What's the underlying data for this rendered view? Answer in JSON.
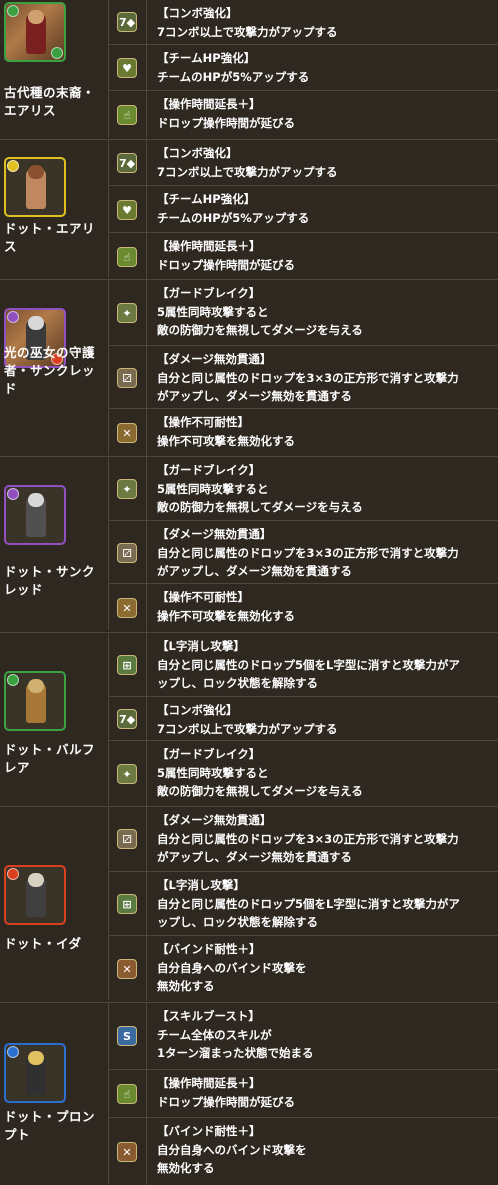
{
  "colors": {
    "background": "#2e2820",
    "grid_line": "#50463a",
    "text": "#ffffff",
    "attr_fire": "#d94020",
    "attr_water": "#2a70d0",
    "attr_wood": "#3aa040",
    "attr_light": "#e0c020",
    "attr_dark": "#9050c0"
  },
  "characters": [
    {
      "name": "古代種の末裔・\nエアリス",
      "avatar": "aerith-portrait-icon",
      "main_attr": "wood",
      "sub_attr": "wood",
      "awakenings": [
        {
          "icon": "combo-boost-icon",
          "glyph": "7◆",
          "title": "【コンボ強化】",
          "text": "7コンボ以上で攻撃力がアップする"
        },
        {
          "icon": "team-hp-boost-icon",
          "glyph": "♥",
          "title": "【チームHP強化】",
          "text": "チームのHPが5%アップする"
        },
        {
          "icon": "time-extend-plus-icon",
          "glyph": "☝",
          "title": "【操作時間延長＋】",
          "text": "ドロップ操作時間が延びる"
        }
      ]
    },
    {
      "name": "ドット・エアリ\nス",
      "avatar": "dot-aerith-sprite-icon",
      "main_attr": "light",
      "sub_attr": "",
      "awakenings": [
        {
          "icon": "combo-boost-icon",
          "glyph": "7◆",
          "title": "【コンボ強化】",
          "text": "7コンボ以上で攻撃力がアップする"
        },
        {
          "icon": "team-hp-boost-icon",
          "glyph": "♥",
          "title": "【チームHP強化】",
          "text": "チームのHPが5%アップする"
        },
        {
          "icon": "time-extend-plus-icon",
          "glyph": "☝",
          "title": "【操作時間延長＋】",
          "text": "ドロップ操作時間が延びる"
        }
      ]
    },
    {
      "name": "光の巫女の守護\n者・サンクレッ\nド",
      "avatar": "sankred-portrait-icon",
      "main_attr": "dark",
      "sub_attr": "fire",
      "awakenings": [
        {
          "icon": "guard-break-icon",
          "glyph": "✦",
          "title": "【ガードブレイク】",
          "text": "5属性同時攻撃すると\n敵の防御力を無視してダメージを与える"
        },
        {
          "icon": "damage-void-pierce-icon",
          "glyph": "⚂",
          "title": "【ダメージ無効貫通】",
          "text": "自分と同じ属性のドロップを3×3の正方形で消すと攻撃力\nがアップし、ダメージ無効を貫通する"
        },
        {
          "icon": "unbind-resist-icon",
          "glyph": "✕",
          "title": "【操作不可耐性】",
          "text": "操作不可攻撃を無効化する"
        }
      ]
    },
    {
      "name": "ドット・サンク\nレッド",
      "avatar": "dot-sankred-sprite-icon",
      "main_attr": "dark",
      "sub_attr": "",
      "awakenings": [
        {
          "icon": "guard-break-icon",
          "glyph": "✦",
          "title": "【ガードブレイク】",
          "text": "5属性同時攻撃すると\n敵の防御力を無視してダメージを与える"
        },
        {
          "icon": "damage-void-pierce-icon",
          "glyph": "⚂",
          "title": "【ダメージ無効貫通】",
          "text": "自分と同じ属性のドロップを3×3の正方形で消すと攻撃力\nがアップし、ダメージ無効を貫通する"
        },
        {
          "icon": "unbind-resist-icon",
          "glyph": "✕",
          "title": "【操作不可耐性】",
          "text": "操作不可攻撃を無効化する"
        }
      ]
    },
    {
      "name": "ドット・バルフ\nレア",
      "avatar": "dot-balthier-sprite-icon",
      "main_attr": "wood",
      "sub_attr": "",
      "awakenings": [
        {
          "icon": "l-shape-attack-icon",
          "glyph": "⊞",
          "title": "【L字消し攻撃】",
          "text": "自分と同じ属性のドロップ5個をL字型に消すと攻撃力がア\nップし、ロック状態を解除する"
        },
        {
          "icon": "combo-boost-icon",
          "glyph": "7◆",
          "title": "【コンボ強化】",
          "text": "7コンボ以上で攻撃力がアップする"
        },
        {
          "icon": "guard-break-icon",
          "glyph": "✦",
          "title": "【ガードブレイク】",
          "text": "5属性同時攻撃すると\n敵の防御力を無視してダメージを与える"
        }
      ]
    },
    {
      "name": "ドット・イダ",
      "avatar": "dot-ida-sprite-icon",
      "main_attr": "fire",
      "sub_attr": "",
      "awakenings": [
        {
          "icon": "damage-void-pierce-icon",
          "glyph": "⚂",
          "title": "【ダメージ無効貫通】",
          "text": "自分と同じ属性のドロップを3×3の正方形で消すと攻撃力\nがアップし、ダメージ無効を貫通する"
        },
        {
          "icon": "l-shape-attack-icon",
          "glyph": "⊞",
          "title": "【L字消し攻撃】",
          "text": "自分と同じ属性のドロップ5個をL字型に消すと攻撃力がア\nップし、ロック状態を解除する"
        },
        {
          "icon": "bind-resist-plus-icon",
          "glyph": "✕",
          "title": "【バインド耐性＋】",
          "text": "自分自身へのバインド攻撃を\n無効化する"
        }
      ]
    },
    {
      "name": "ドット・プロン\nプト",
      "avatar": "dot-prompto-sprite-icon",
      "main_attr": "water",
      "sub_attr": "",
      "awakenings": [
        {
          "icon": "skill-boost-icon",
          "glyph": "S",
          "title": "【スキルブースト】",
          "text": "チーム全体のスキルが\n1ターン溜まった状態で始まる"
        },
        {
          "icon": "time-extend-plus-icon",
          "glyph": "☝",
          "title": "【操作時間延長＋】",
          "text": "ドロップ操作時間が延びる"
        },
        {
          "icon": "bind-resist-plus-icon",
          "glyph": "✕",
          "title": "【バインド耐性＋】",
          "text": "自分自身へのバインド攻撃を\n無効化する"
        }
      ]
    }
  ]
}
